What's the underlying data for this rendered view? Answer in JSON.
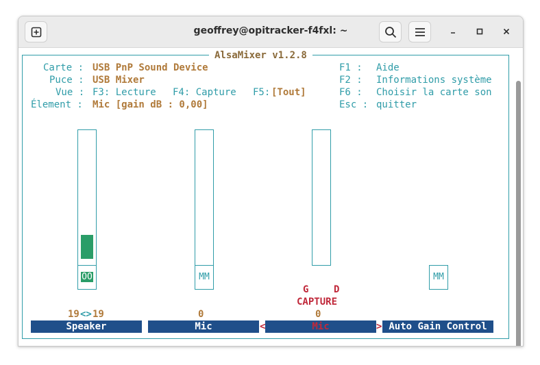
{
  "window": {
    "title": "geoffrey@opitracker-f4fxl: ~"
  },
  "icons": {
    "new_tab": "new-tab-icon",
    "search": "search-icon",
    "menu": "hamburger-menu-icon",
    "minimize": "minimize-icon",
    "maximize": "maximize-icon",
    "close": "close-icon"
  },
  "mixer": {
    "app_title": "AlsaMixer v1.2.8",
    "info": {
      "card_label": "Carte :",
      "card_value": "USB PnP Sound Device",
      "chip_label": "Puce :",
      "chip_value": "USB Mixer",
      "view_label": "Vue :",
      "view_f3": "F3: Lecture",
      "view_f4": "F4: Capture",
      "view_f5_key": "F5:",
      "view_f5_value": "[Tout]",
      "element_label": "Élement :",
      "element_value": "Mic [gain dB : 0,00]"
    },
    "help": {
      "f1_key": "F1 :",
      "f1_value": "Aide",
      "f2_key": "F2 :",
      "f2_value": "Informations système",
      "f6_key": "F6 :",
      "f6_value": "Choisir la carte son",
      "esc_key": "Esc :",
      "esc_value": "quitter"
    },
    "controls": [
      {
        "name": "Speaker",
        "value_left": "19",
        "value_arrow": "<>",
        "value_right": "19",
        "mute": "OO",
        "level": 0.19
      },
      {
        "name": "Mic",
        "value": "0",
        "mute": "MM",
        "level": 0
      },
      {
        "name": "Mic",
        "value": "0",
        "capture_left": "G",
        "capture_right": "D",
        "capture_label": "CAPTURE",
        "level": 0,
        "selected": true,
        "left_marker": "<",
        "right_marker": ">"
      },
      {
        "name": "Auto Gain Control",
        "mute": "MM"
      }
    ],
    "colors": {
      "accent": "#2f9ca8",
      "value_text": "#b07a3a",
      "level_fill": "#2a9d68",
      "label_bg": "#1f4f8a",
      "selected": "#c0283a"
    }
  }
}
